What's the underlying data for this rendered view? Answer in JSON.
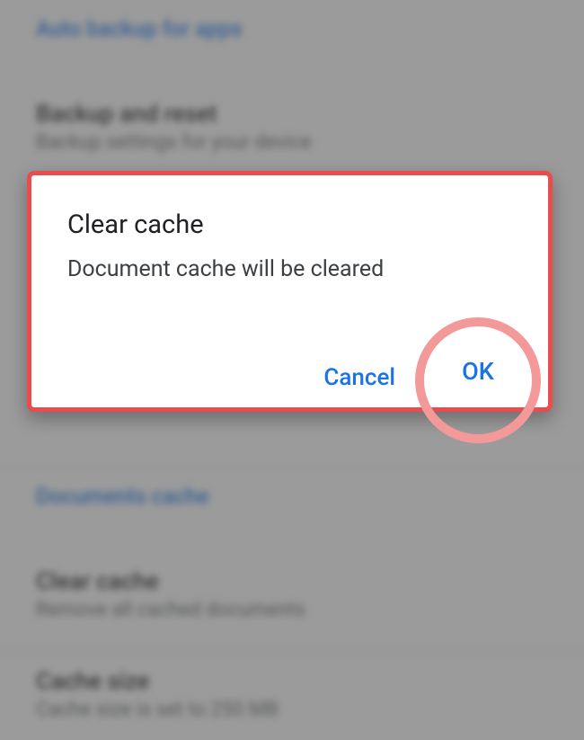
{
  "background": {
    "autoBackupLink": "Auto backup for apps",
    "backupHeading": "Backup and reset",
    "backupSubtext": "Backup settings for your device",
    "docsCacheLink": "Documents cache",
    "clearCacheHeading": "Clear cache",
    "clearCacheSubtext": "Remove all cached documents",
    "cacheSizeHeading": "Cache size",
    "cacheSizeSubtext": "Cache size is set to 250 MB"
  },
  "dialog": {
    "title": "Clear cache",
    "message": "Document cache will be cleared",
    "cancelLabel": "Cancel",
    "okLabel": "OK"
  }
}
